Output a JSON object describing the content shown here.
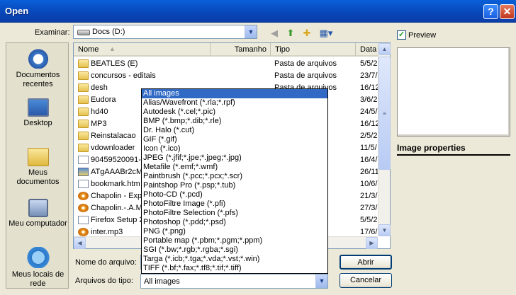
{
  "window": {
    "title": "Open"
  },
  "lookin": {
    "label": "Examinar:",
    "value": "Docs (D:)"
  },
  "places": [
    {
      "label": "Documentos recentes",
      "icon": "recent-documents-icon"
    },
    {
      "label": "Desktop",
      "icon": "desktop-icon"
    },
    {
      "label": "Meus documentos",
      "icon": "my-documents-icon"
    },
    {
      "label": "Meu computador",
      "icon": "my-computer-icon"
    },
    {
      "label": "Meus locais de rede",
      "icon": "network-places-icon"
    }
  ],
  "columns": {
    "name": "Nome",
    "size": "Tamanho",
    "type": "Tipo",
    "date": "Data"
  },
  "files": [
    {
      "name": "BEATLES (E)",
      "type": "Pasta de arquivos",
      "date": "5/5/2",
      "icon": "folder"
    },
    {
      "name": "concursos - editais",
      "type": "Pasta de arquivos",
      "date": "23/7/",
      "icon": "folder"
    },
    {
      "name": "desh",
      "type": "Pasta de arquivos",
      "date": "16/12",
      "icon": "folder"
    },
    {
      "name": "Eudora",
      "type": "",
      "date": "3/6/2",
      "icon": "folder"
    },
    {
      "name": "hd40",
      "type": "",
      "date": "24/5/",
      "icon": "folder"
    },
    {
      "name": "MP3",
      "type": "",
      "date": "16/12",
      "icon": "folder"
    },
    {
      "name": "Reinstalacao",
      "type": "",
      "date": "2/5/2",
      "icon": "folder"
    },
    {
      "name": "vdownloader",
      "type": "",
      "date": "11/5/",
      "icon": "folder"
    },
    {
      "name": "90459520091-",
      "type": "",
      "date": "16/4/",
      "icon": "file"
    },
    {
      "name": "ATgAAABr2cMr",
      "type": "",
      "date": "26/11",
      "icon": "img"
    },
    {
      "name": "bookmark.htm",
      "type": "",
      "date": "10/6/",
      "icon": "file"
    },
    {
      "name": "Chapolin - Expe",
      "type": "ws",
      "date": "21/3/",
      "icon": "media"
    },
    {
      "name": "Chapolin.-.A.M",
      "type": "ws",
      "date": "27/3/",
      "icon": "media"
    },
    {
      "name": "Firefox Setup 2",
      "type": "ws",
      "date": "5/5/2",
      "icon": "file"
    },
    {
      "name": "inter.mp3",
      "type": "a MP3",
      "date": "17/6/",
      "icon": "media"
    }
  ],
  "filename": {
    "label": "Nome do arquivo:",
    "value": ""
  },
  "filetype": {
    "label": "Arquivos do tipo:",
    "value": "All images"
  },
  "filetype_options": [
    "All images",
    "Alias/Wavefront (*.rla;*.rpf)",
    "Autodesk (*.cel;*.pic)",
    "BMP (*.bmp;*.dib;*.rle)",
    "Dr. Halo (*.cut)",
    "GIF (*.gif)",
    "Icon (*.ico)",
    "JPEG (*.jfif;*.jpe;*.jpeg;*.jpg)",
    "Metafile (*.emf;*.wmf)",
    "Paintbrush (*.pcc;*.pcx;*.scr)",
    "Paintshop Pro (*.psp;*.tub)",
    "Photo-CD (*.pcd)",
    "PhotoFiltre Image (*.pfi)",
    "PhotoFiltre Selection (*.pfs)",
    "Photoshop (*.pdd;*.psd)",
    "PNG (*.png)",
    "Portable map (*.pbm;*.pgm;*.ppm)",
    "SGI (*.bw;*.rgb;*.rgba;*.sgi)",
    "Targa (*.icb;*.tga;*.vda;*.vst;*.win)",
    "TIFF (*.bf;*.fax;*.tf8;*.tif;*.tiff)"
  ],
  "buttons": {
    "open": "Abrir",
    "cancel": "Cancelar"
  },
  "preview": {
    "label": "Preview",
    "checked": true,
    "properties_title": "Image properties"
  }
}
